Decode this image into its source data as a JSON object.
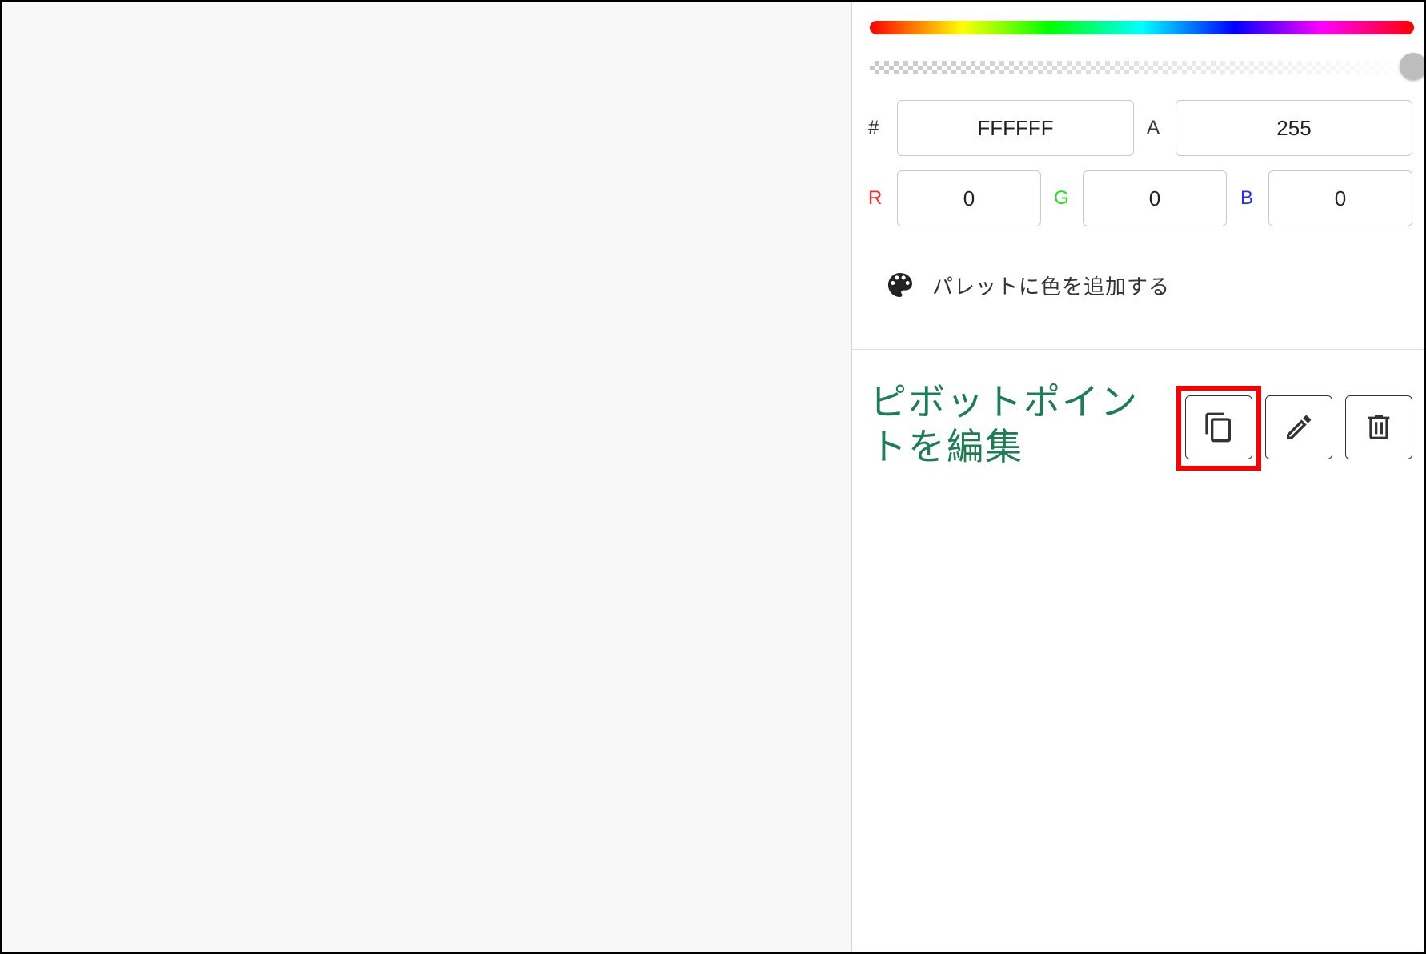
{
  "color_picker": {
    "hex_label": "#",
    "hex_value": "FFFFFF",
    "alpha_label": "A",
    "alpha_value": "255",
    "r_label": "R",
    "r_value": "0",
    "g_label": "G",
    "g_value": "0",
    "b_label": "B",
    "b_value": "0",
    "alpha_slider_level": 1.0,
    "colors": {
      "r_label": "#ff2a2a",
      "g_label": "#22dd22",
      "b_label": "#2a2aff"
    }
  },
  "palette": {
    "add_label": "パレットに色を追加する",
    "icon": "palette-icon"
  },
  "pivot_section": {
    "title": "ピボットポイントを編集",
    "title_color": "#1e7d55",
    "buttons": [
      {
        "icon": "copy-icon",
        "highlighted": true
      },
      {
        "icon": "pencil-icon",
        "highlighted": false
      },
      {
        "icon": "trash-icon",
        "highlighted": false
      }
    ],
    "highlight_color": "#ff0000"
  }
}
